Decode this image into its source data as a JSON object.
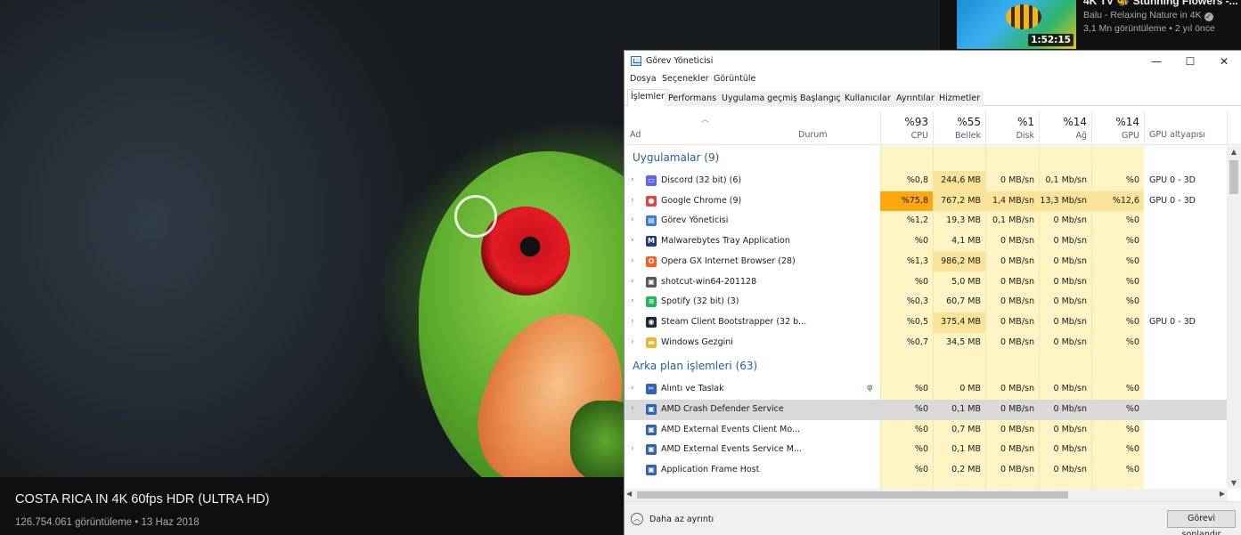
{
  "youtube": {
    "video_title": "COSTA RICA IN 4K 60fps HDR (ULTRA HD)",
    "video_meta": "126.754.061 görüntüleme • 13 Haz 2018",
    "recommendation": {
      "title": "4K TV 🐝 Stunning Flowers -...",
      "channel": "Balu - Relaxing Nature in 4K",
      "meta": "3,1 Mn görüntüleme • 2 yıl önce",
      "duration": "1:52:15"
    }
  },
  "taskmanager": {
    "title": "Görev Yöneticisi",
    "window_buttons": {
      "minimize": "—",
      "maximize": "☐",
      "close": "✕"
    },
    "menu": [
      "Dosya",
      "Seçenekler",
      "Görüntüle"
    ],
    "tabs": [
      "İşlemler",
      "Performans",
      "Uygulama geçmişi",
      "Başlangıç",
      "Kullanıcılar",
      "Ayrıntılar",
      "Hizmetler"
    ],
    "active_tab": "İşlemler",
    "columns": {
      "name": "Ad",
      "status": "Durum",
      "cpu": {
        "pct": "%93",
        "label": "CPU"
      },
      "memory": {
        "pct": "%55",
        "label": "Bellek"
      },
      "disk": {
        "pct": "%1",
        "label": "Disk"
      },
      "network": {
        "pct": "%14",
        "label": "Ağ"
      },
      "gpu": {
        "pct": "%14",
        "label": "GPU"
      },
      "gpu_engine": "GPU altyapısı"
    },
    "groups": {
      "apps": "Uygulamalar (9)",
      "background": "Arka plan işlemleri (63)"
    },
    "apps": [
      {
        "name": "Discord (32 bit) (6)",
        "cpu": "%0,8",
        "mem": "244,6 MB",
        "disk": "0 MB/sn",
        "net": "0,1 Mb/sn",
        "gpu": "%0",
        "eng": "GPU 0 - 3D"
      },
      {
        "name": "Google Chrome (9)",
        "cpu": "%75,8",
        "mem": "767,2 MB",
        "disk": "1,4 MB/sn",
        "net": "13,3 Mb/sn",
        "gpu": "%12,6",
        "eng": "GPU 0 - 3D"
      },
      {
        "name": "Görev Yöneticisi",
        "cpu": "%1,2",
        "mem": "19,3 MB",
        "disk": "0,1 MB/sn",
        "net": "0 Mb/sn",
        "gpu": "%0",
        "eng": ""
      },
      {
        "name": "Malwarebytes Tray Application",
        "cpu": "%0",
        "mem": "4,1 MB",
        "disk": "0 MB/sn",
        "net": "0 Mb/sn",
        "gpu": "%0",
        "eng": ""
      },
      {
        "name": "Opera GX Internet Browser (28)",
        "cpu": "%1,3",
        "mem": "986,2 MB",
        "disk": "0 MB/sn",
        "net": "0 Mb/sn",
        "gpu": "%0",
        "eng": ""
      },
      {
        "name": "shotcut-win64-201128",
        "cpu": "%0",
        "mem": "5,0 MB",
        "disk": "0 MB/sn",
        "net": "0 Mb/sn",
        "gpu": "%0",
        "eng": ""
      },
      {
        "name": "Spotify (32 bit) (3)",
        "cpu": "%0,3",
        "mem": "60,7 MB",
        "disk": "0 MB/sn",
        "net": "0 Mb/sn",
        "gpu": "%0",
        "eng": ""
      },
      {
        "name": "Steam Client Bootstrapper (32 b...",
        "cpu": "%0,5",
        "mem": "375,4 MB",
        "disk": "0 MB/sn",
        "net": "0 Mb/sn",
        "gpu": "%0",
        "eng": "GPU 0 - 3D"
      },
      {
        "name": "Windows Gezgini",
        "cpu": "%0,7",
        "mem": "34,5 MB",
        "disk": "0 MB/sn",
        "net": "0 Mb/sn",
        "gpu": "%0",
        "eng": ""
      }
    ],
    "background": [
      {
        "name": "Alıntı ve Taslak",
        "cpu": "%0",
        "mem": "0 MB",
        "disk": "0 MB/sn",
        "net": "0 Mb/sn",
        "gpu": "%0",
        "eng": ""
      },
      {
        "name": "AMD Crash Defender Service",
        "cpu": "%0",
        "mem": "0,1 MB",
        "disk": "0 MB/sn",
        "net": "0 Mb/sn",
        "gpu": "%0",
        "eng": ""
      },
      {
        "name": "AMD External Events Client Mo...",
        "cpu": "%0",
        "mem": "0,7 MB",
        "disk": "0 MB/sn",
        "net": "0 Mb/sn",
        "gpu": "%0",
        "eng": ""
      },
      {
        "name": "AMD External Events Service M...",
        "cpu": "%0",
        "mem": "0,1 MB",
        "disk": "0 MB/sn",
        "net": "0 Mb/sn",
        "gpu": "%0",
        "eng": ""
      },
      {
        "name": "Application Frame Host",
        "cpu": "%0",
        "mem": "0,2 MB",
        "disk": "0 MB/sn",
        "net": "0 Mb/sn",
        "gpu": "%0",
        "eng": ""
      }
    ],
    "footer": {
      "fewer_details": "Daha az ayrıntı",
      "end_task": "Görevi sonlandır"
    },
    "colors": {
      "heat_low": "#fff4c4",
      "heat_mid": "#f9e49a",
      "heat_high": "#ffa70f",
      "group_title": "#1f5fa8",
      "selected_row": "#d9d9d9"
    }
  }
}
